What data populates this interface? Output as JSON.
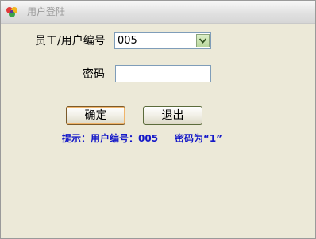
{
  "window": {
    "title": "用户登陆"
  },
  "form": {
    "user_label": "员工/用户编号",
    "user_value": "005",
    "password_label": "密码",
    "password_value": ""
  },
  "buttons": {
    "ok_label": "确定",
    "exit_label": "退出"
  },
  "hint": {
    "text": "提示：用户编号：005     密码为“1”"
  },
  "colors": {
    "hint": "#1418c8",
    "background": "#ece9d8"
  },
  "icons": {
    "app": "colorful-app-icon",
    "dropdown": "chevron-down-icon"
  }
}
